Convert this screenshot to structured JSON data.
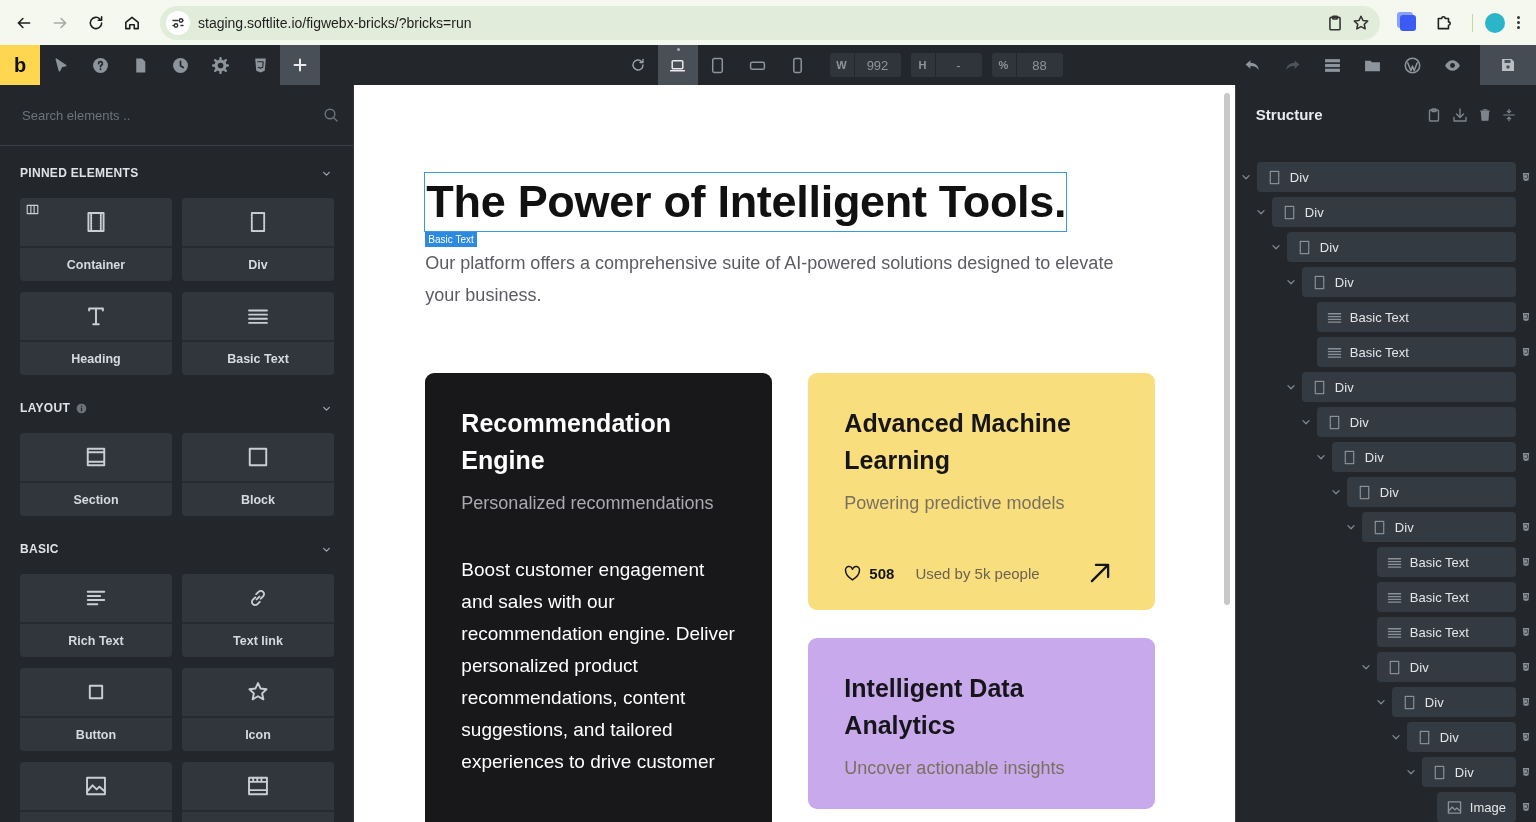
{
  "browser": {
    "url": "staging.softlite.io/figwebx-bricks/?bricks=run",
    "nav": [
      {
        "kind": "back",
        "disabled": false
      },
      {
        "kind": "forward",
        "disabled": true
      },
      {
        "kind": "reload",
        "disabled": false
      },
      {
        "kind": "home",
        "disabled": false
      }
    ]
  },
  "toolbar": {
    "logo": "b",
    "left_tools": [
      {
        "kind": "pointer",
        "active": false
      },
      {
        "kind": "help",
        "active": false
      },
      {
        "kind": "page",
        "active": false
      },
      {
        "kind": "history",
        "active": false
      },
      {
        "kind": "settings",
        "active": false
      },
      {
        "kind": "css",
        "active": false
      },
      {
        "kind": "plus",
        "active": true
      }
    ],
    "devices": [
      {
        "kind": "laptop",
        "selected": true
      },
      {
        "kind": "tablet",
        "selected": false
      },
      {
        "kind": "landscape",
        "selected": false
      },
      {
        "kind": "phone",
        "selected": false
      }
    ],
    "size_fields": [
      {
        "label": "W",
        "value": "992"
      },
      {
        "label": "H",
        "value": "-"
      },
      {
        "label": "%",
        "value": "88"
      }
    ],
    "right_tools": [
      {
        "kind": "undo",
        "disabled": false
      },
      {
        "kind": "redo",
        "disabled": true
      },
      {
        "kind": "stack",
        "disabled": false
      },
      {
        "kind": "folder",
        "disabled": false
      },
      {
        "kind": "wordpress",
        "disabled": false
      },
      {
        "kind": "eye",
        "disabled": false
      }
    ]
  },
  "elements_panel": {
    "search": {
      "placeholder": "Search elements .."
    },
    "sections": [
      {
        "title": "PINNED ELEMENTS",
        "info": false,
        "items": [
          {
            "kind": "container",
            "label": "Container"
          },
          {
            "kind": "div",
            "label": "Div"
          },
          {
            "kind": "heading",
            "label": "Heading"
          },
          {
            "kind": "text",
            "label": "Basic Text"
          }
        ]
      },
      {
        "title": "LAYOUT",
        "info": true,
        "items": [
          {
            "kind": "section",
            "label": "Section"
          },
          {
            "kind": "block",
            "label": "Block"
          }
        ]
      },
      {
        "title": "BASIC",
        "info": false,
        "items": [
          {
            "kind": "richtext",
            "label": "Rich Text"
          },
          {
            "kind": "link",
            "label": "Text link"
          },
          {
            "kind": "button",
            "label": "Button"
          },
          {
            "kind": "icon",
            "label": "Icon"
          },
          {
            "kind": "image"
          },
          {
            "kind": "video"
          }
        ]
      }
    ]
  },
  "canvas": {
    "heading": {
      "text": "The Power of Intelligent Tools.",
      "selected": true,
      "selection_tag": "Basic Text"
    },
    "subtitle": "Our platform offers a comprehensive suite of AI-powered solutions designed to elevate your business.",
    "cards": [
      {
        "title": "Recommendation Engine",
        "subtitle": "Personalized recommendations",
        "color": "#18181b",
        "body": "Boost customer engagement and sales with our recommendation engine. Deliver personalized product recommendations, content suggestions, and tailored experiences to drive customer"
      },
      {
        "title": "Advanced Machine Learning",
        "subtitle": "Powering predictive models",
        "color": "#f8de7c",
        "likes": "508",
        "usage": "Used by 5k people"
      },
      {
        "title": "Intelligent Data Analytics",
        "subtitle": "Uncover actionable insights",
        "color": "#c8aaec"
      }
    ]
  },
  "structure": {
    "title": "Structure",
    "tree": [
      {
        "kind": "div",
        "label": "Div",
        "has_styles": true,
        "expanded": true,
        "children": [
          {
            "kind": "div",
            "label": "Div",
            "has_styles": false,
            "expanded": true,
            "children": [
              {
                "kind": "div",
                "label": "Div",
                "has_styles": false,
                "expanded": true,
                "children": [
                  {
                    "kind": "div",
                    "label": "Div",
                    "has_styles": false,
                    "expanded": true,
                    "children": [
                      {
                        "kind": "text",
                        "label": "Basic Text",
                        "has_styles": true
                      },
                      {
                        "kind": "text",
                        "label": "Basic Text",
                        "has_styles": true
                      }
                    ]
                  },
                  {
                    "kind": "div",
                    "label": "Div",
                    "has_styles": false,
                    "expanded": true,
                    "children": [
                      {
                        "kind": "div",
                        "label": "Div",
                        "has_styles": false,
                        "expanded": true,
                        "children": [
                          {
                            "kind": "div",
                            "label": "Div",
                            "has_styles": true,
                            "expanded": true,
                            "children": [
                              {
                                "kind": "div",
                                "label": "Div",
                                "has_styles": false,
                                "expanded": true,
                                "children": [
                                  {
                                    "kind": "div",
                                    "label": "Div",
                                    "has_styles": true,
                                    "expanded": true,
                                    "children": [
                                      {
                                        "kind": "text",
                                        "label": "Basic Text",
                                        "has_styles": true
                                      },
                                      {
                                        "kind": "text",
                                        "label": "Basic Text",
                                        "has_styles": true
                                      },
                                      {
                                        "kind": "text",
                                        "label": "Basic Text",
                                        "has_styles": true
                                      },
                                      {
                                        "kind": "div",
                                        "label": "Div",
                                        "has_styles": true,
                                        "expanded": true,
                                        "children": [
                                          {
                                            "kind": "div",
                                            "label": "Div",
                                            "has_styles": true,
                                            "expanded": true,
                                            "children": [
                                              {
                                                "kind": "div",
                                                "label": "Div",
                                                "has_styles": true,
                                                "expanded": true,
                                                "children": [
                                                  {
                                                    "kind": "div",
                                                    "label": "Div",
                                                    "has_styles": true,
                                                    "expanded": true,
                                                    "children": [
                                                      {
                                                        "kind": "image",
                                                        "label": "Image",
                                                        "has_styles": true
                                                      }
                                                    ]
                                                  }
                                                ]
                                              }
                                            ]
                                          }
                                        ]
                                      }
                                    ]
                                  }
                                ]
                              }
                            ]
                          }
                        ]
                      }
                    ]
                  }
                ]
              }
            ]
          }
        ]
      }
    ]
  }
}
